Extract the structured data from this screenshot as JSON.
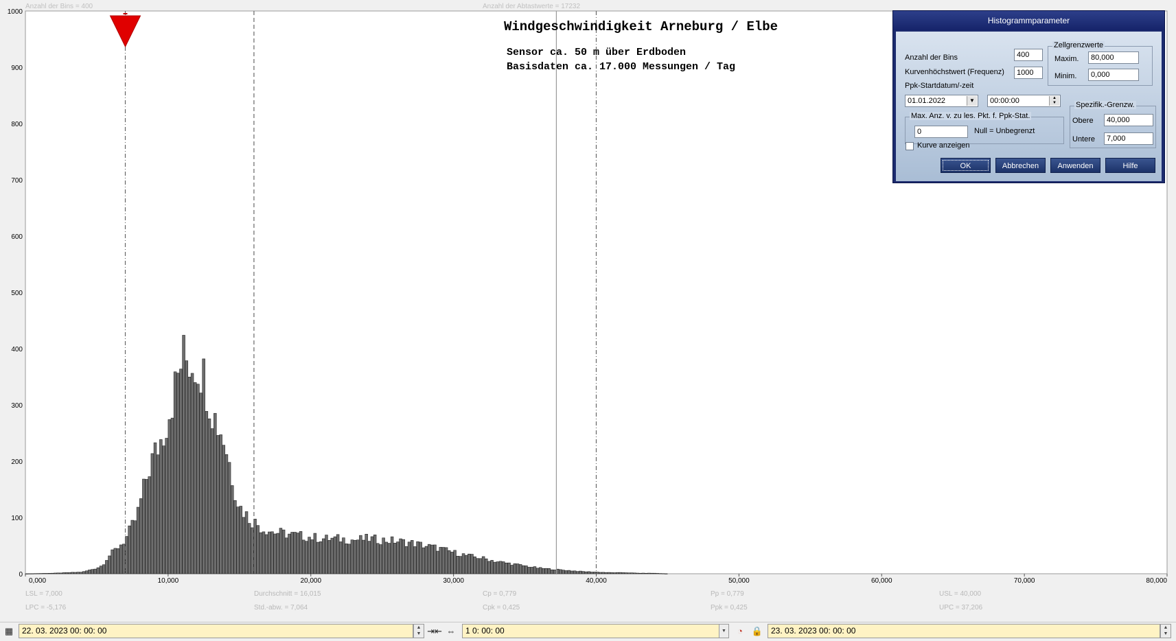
{
  "header": {
    "bins_text": "Anzahl der Bins = 400",
    "samples_text": "Anzahl der Abtastwerte = 17232"
  },
  "title": {
    "main": "Windgeschwindigkeit  Arneburg / Elbe",
    "line1": "Sensor ca. 50 m über Erdboden",
    "line2": "Basisdaten ca. 17.000 Messungen / Tag"
  },
  "stats": {
    "lsl": "LSL = 7,000",
    "lpc": "LPC = -5,176",
    "mean": "Durchschnitt = 16,015",
    "stddev": "Std.-abw. = 7,064",
    "cp": "Cp = 0,779",
    "cpk": "Cpk = 0,425",
    "pp": "Pp = 0,779",
    "ppk": "Ppk = 0,425",
    "usl": "USL = 40,000",
    "upc": "UPC = 37,206"
  },
  "chart_data": {
    "type": "bar",
    "title": "Windgeschwindigkeit  Arneburg / Elbe",
    "xlim": [
      0,
      80
    ],
    "ylim": [
      0,
      1000
    ],
    "bin_width": 0.2,
    "x_ticks": [
      "0,000",
      "10,000",
      "20,000",
      "30,000",
      "40,000",
      "50,000",
      "60,000",
      "70,000",
      "80,000"
    ],
    "y_ticks": [
      "0",
      "100",
      "200",
      "300",
      "400",
      "500",
      "600",
      "700",
      "800",
      "900",
      "1000"
    ],
    "reference_lines": [
      {
        "name": "LSL",
        "x": 7.0,
        "style": "dash-dot"
      },
      {
        "name": "Durchschnitt",
        "x": 16.015,
        "style": "dashed"
      },
      {
        "name": "UPC",
        "x": 37.206,
        "style": "solid"
      },
      {
        "name": "USL",
        "x": 40.0,
        "style": "dash-dot"
      }
    ],
    "marker_x": 7.0,
    "profile": [
      [
        0,
        0
      ],
      [
        2,
        1
      ],
      [
        3,
        2
      ],
      [
        4,
        3
      ],
      [
        5,
        10
      ],
      [
        5.4,
        15
      ],
      [
        5.8,
        30
      ],
      [
        6.2,
        40
      ],
      [
        6.6,
        50
      ],
      [
        7,
        60
      ],
      [
        7.4,
        80
      ],
      [
        7.8,
        100
      ],
      [
        8.2,
        140
      ],
      [
        8.6,
        180
      ],
      [
        9,
        210
      ],
      [
        9.4,
        230
      ],
      [
        9.8,
        260
      ],
      [
        10.2,
        300
      ],
      [
        10.6,
        340
      ],
      [
        11,
        385
      ],
      [
        11.4,
        380
      ],
      [
        11.8,
        375
      ],
      [
        12.2,
        370
      ],
      [
        12.6,
        345
      ],
      [
        13,
        300
      ],
      [
        13.4,
        270
      ],
      [
        13.8,
        250
      ],
      [
        14.2,
        210
      ],
      [
        14.6,
        160
      ],
      [
        15,
        120
      ],
      [
        15.4,
        108
      ],
      [
        15.8,
        95
      ],
      [
        16.2,
        90
      ],
      [
        16.6,
        80
      ],
      [
        17,
        78
      ],
      [
        17.4,
        74
      ],
      [
        18,
        72
      ],
      [
        19,
        68
      ],
      [
        20,
        65
      ],
      [
        21,
        62
      ],
      [
        22,
        62
      ],
      [
        23,
        60
      ],
      [
        24,
        62
      ],
      [
        25,
        60
      ],
      [
        26,
        58
      ],
      [
        27,
        55
      ],
      [
        28,
        50
      ],
      [
        29,
        45
      ],
      [
        30,
        38
      ],
      [
        31,
        32
      ],
      [
        32,
        28
      ],
      [
        33,
        22
      ],
      [
        34,
        18
      ],
      [
        35,
        14
      ],
      [
        36,
        10
      ],
      [
        37,
        8
      ],
      [
        38,
        6
      ],
      [
        39,
        4
      ],
      [
        40,
        3
      ],
      [
        41,
        2
      ],
      [
        42,
        2
      ],
      [
        43,
        1
      ],
      [
        44,
        1
      ],
      [
        45,
        0
      ],
      [
        80,
        0
      ]
    ]
  },
  "dialog": {
    "title": "Histogrammparameter",
    "bins_label": "Anzahl der Bins",
    "bins_value": "400",
    "peak_label": "Kurvenhöchstwert (Frequenz)",
    "peak_value": "1000",
    "start_label": "Ppk-Startdatum/-zeit",
    "start_date": "01.01.2022",
    "start_time": "00:00:00",
    "cell_group": "Zellgrenzwerte",
    "max_label": "Maxim.",
    "max_value": "80,000",
    "min_label": "Minim.",
    "min_value": "0,000",
    "maxpts_group": "Max. Anz. v. zu les. Pkt. f. Ppk-Stat.",
    "maxpts_value": "0",
    "maxpts_hint": "Null = Unbegrenzt",
    "spec_group": "Spezifik.-Grenzw.",
    "upper_label": "Obere",
    "upper_value": "40,000",
    "lower_label": "Untere",
    "lower_value": "7,000",
    "show_curve_label": "Kurve anzeigen",
    "ok": "OK",
    "cancel": "Abbrechen",
    "apply": "Anwenden",
    "help": "Hilfe"
  },
  "bottombar": {
    "start": "22. 03. 2023    00: 00: 00",
    "interval": "1  0: 00: 00",
    "end": "23. 03. 2023    00: 00: 00"
  }
}
